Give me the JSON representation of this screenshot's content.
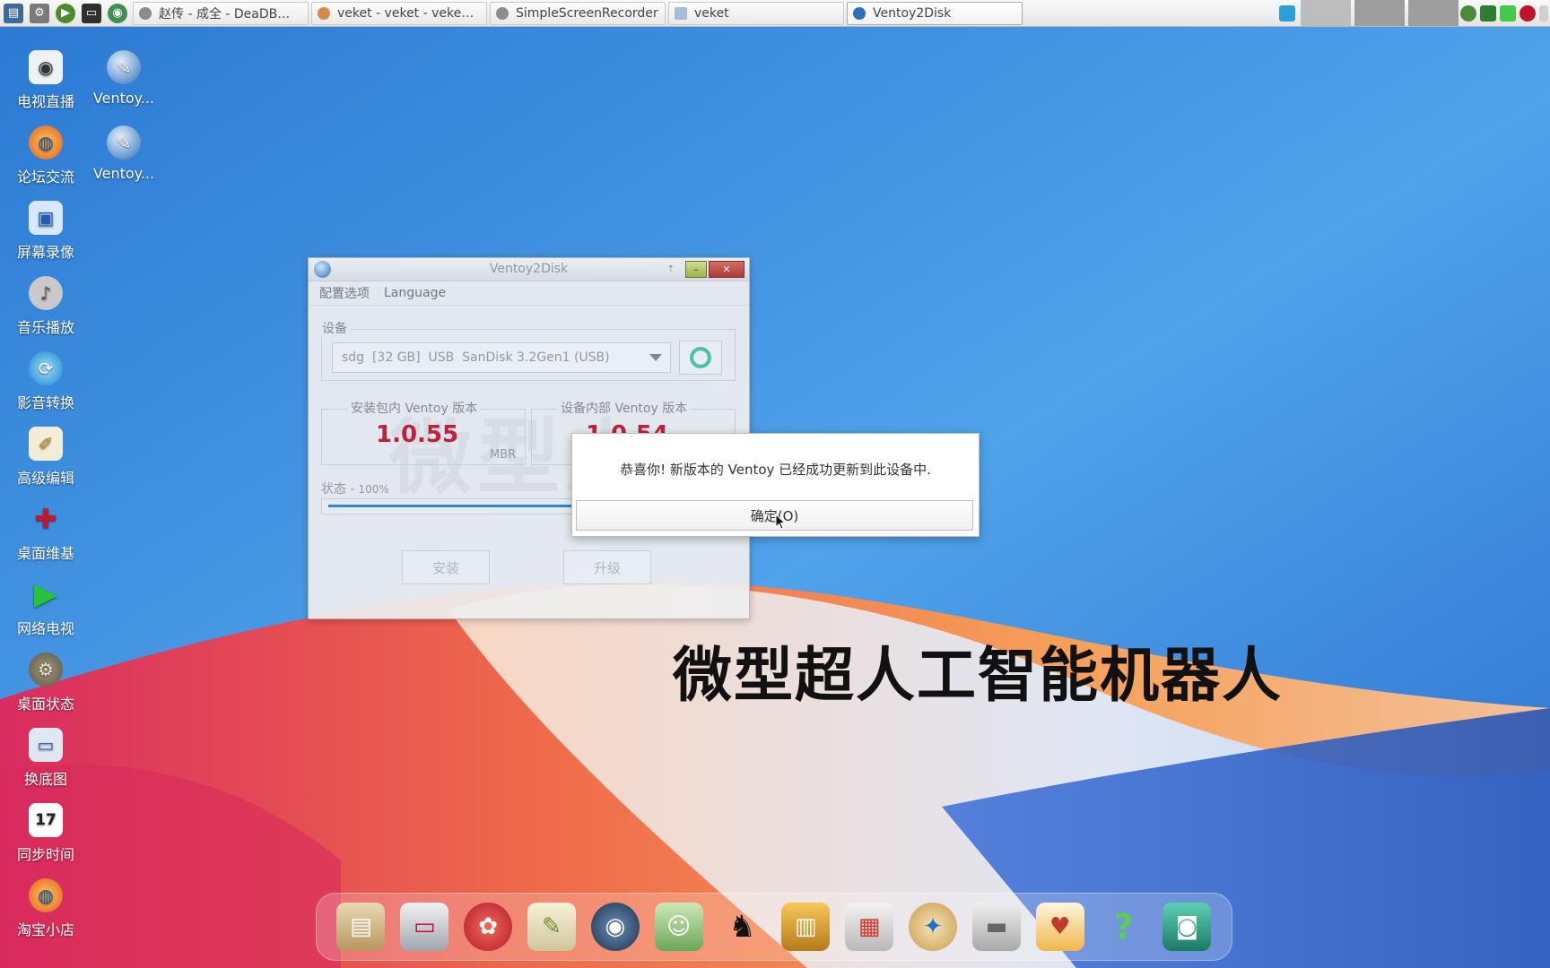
{
  "taskbar": {
    "tasks": [
      {
        "label": "赵传 - 成全 - DeaDB…",
        "icon": "media-icon"
      },
      {
        "label": "veket - veket - veke…",
        "icon": "browser-icon"
      },
      {
        "label": "SimpleScreenRecorder",
        "icon": "recorder-icon"
      },
      {
        "label": "veket",
        "icon": "folder-icon"
      },
      {
        "label": "Ventoy2Disk",
        "icon": "ventoy-icon"
      }
    ]
  },
  "desktop_icons": [
    {
      "label": "电视直播",
      "icon": "tv-icon"
    },
    {
      "label": "Ventoy...",
      "icon": "ventoy-icon"
    },
    {
      "label": "论坛交流",
      "icon": "firefox-icon"
    },
    {
      "label": "Ventoy...",
      "icon": "ventoy-icon"
    },
    {
      "label": "屏幕录像",
      "icon": "screen-record-icon"
    },
    {
      "label": "音乐播放",
      "icon": "speaker-icon"
    },
    {
      "label": "影音转换",
      "icon": "convert-icon"
    },
    {
      "label": "高级编辑",
      "icon": "editor-icon"
    },
    {
      "label": "桌面维基",
      "icon": "wiki-icon"
    },
    {
      "label": "网络电视",
      "icon": "play-icon"
    },
    {
      "label": "桌面状态",
      "icon": "status-icon"
    },
    {
      "label": "换底图",
      "icon": "monitor-icon"
    },
    {
      "label": "同步时间",
      "icon": "calendar-icon"
    },
    {
      "label": "淘宝小店",
      "icon": "firefox-icon"
    }
  ],
  "window": {
    "title": "Ventoy2Disk",
    "menu": [
      "配置选项",
      "Language"
    ],
    "device_group_label": "设备",
    "device_value": "sdg  [32 GB]  USB  SanDisk 3.2Gen1 (USB)",
    "package_version_label": "安装包内 Ventoy 版本",
    "package_version": "1.0.55",
    "partition_style": "MBR",
    "device_version_label": "设备内部 Ventoy 版本",
    "device_version": "1.0.54",
    "status_label": "状态 -",
    "status_percent": "100%",
    "progress": 1.0,
    "install_button": "安装",
    "upgrade_button": "升级",
    "watermark": "微型人"
  },
  "dialog": {
    "message": "恭喜你! 新版本的 Ventoy 已经成功更新到此设备中.",
    "ok_button": "确定(O)"
  },
  "caption": "微型超人工智能机器人",
  "dock_items": [
    "file-manager-icon",
    "computer-icon",
    "browser-mascot-icon",
    "notes-icon",
    "media-player-icon",
    "users-icon",
    "qq-penguin-icon",
    "notebook-icon",
    "presentation-icon",
    "paint-icon",
    "usb-drive-icon",
    "veket-mascot-icon",
    "help-icon",
    "camera-icon"
  ],
  "colors": {
    "version_red": "#c9182f",
    "progress_blue": "#2b84d8",
    "refresh_green": "#4cc7a6"
  }
}
